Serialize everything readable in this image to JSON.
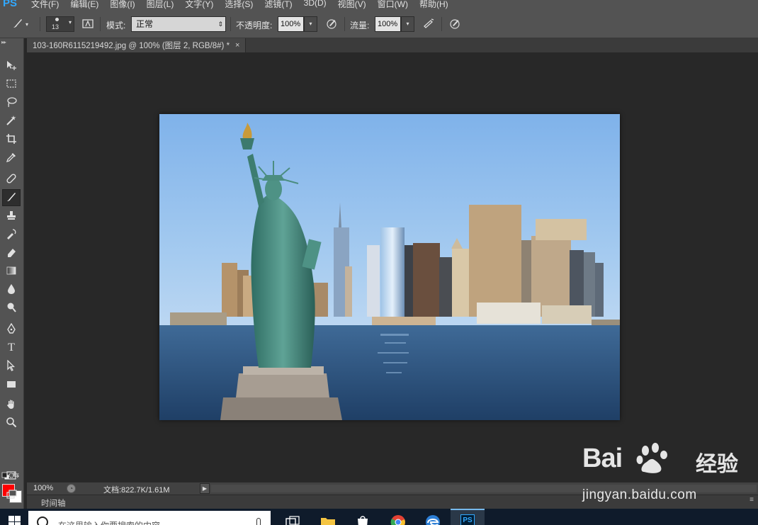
{
  "app": {
    "logo": "PS"
  },
  "menu": [
    "文件(F)",
    "编辑(E)",
    "图像(I)",
    "图层(L)",
    "文字(Y)",
    "选择(S)",
    "滤镜(T)",
    "3D(D)",
    "视图(V)",
    "窗口(W)",
    "帮助(H)"
  ],
  "options": {
    "brush_size": "13",
    "mode_label": "模式:",
    "mode_value": "正常",
    "opacity_label": "不透明度:",
    "opacity_value": "100%",
    "flow_label": "流量:",
    "flow_value": "100%"
  },
  "document": {
    "tab_title": "103-160R6115219492.jpg @ 100% (图层 2, RGB/8#) *",
    "close_symbol": "×"
  },
  "tools": [
    "move-tool",
    "marquee-tool",
    "lasso-tool",
    "magic-wand-tool",
    "crop-tool",
    "eyedropper-tool",
    "healing-brush-tool",
    "brush-tool",
    "clone-stamp-tool",
    "history-brush-tool",
    "eraser-tool",
    "gradient-tool",
    "blur-tool",
    "dodge-tool",
    "pen-tool",
    "type-tool",
    "path-selection-tool",
    "rectangle-tool",
    "hand-tool",
    "zoom-tool",
    "quick-mask-tool",
    "screen-mode-tool"
  ],
  "active_tool": "brush-tool",
  "colors": {
    "foreground": "#ff0000",
    "background": "#ffffff",
    "accent": "#31a8ff"
  },
  "status": {
    "zoom": "100%",
    "doc_size": "文档:822.7K/1.61M"
  },
  "timeline": {
    "label": "时间轴"
  },
  "taskbar": {
    "search_placeholder": "在这里输入你要搜索的内容",
    "apps": [
      "task-view",
      "file-explorer",
      "store",
      "chrome",
      "edge",
      "photoshop"
    ]
  },
  "watermark": {
    "brand_left": "Bai",
    "brand_right": "经验",
    "url": "jingyan.baidu.com"
  }
}
